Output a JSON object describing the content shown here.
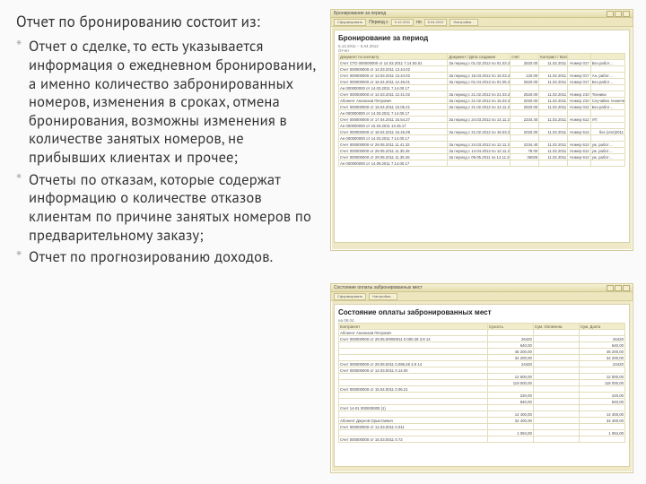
{
  "text": {
    "intro": "Отчет по бронированию состоит из:",
    "b1": "Отчет о сделке, то есть указывается информация о ежедневном бронировании, а именно количество забронированных номеров, изменения в сроках, отмена бронирования, возможны изменения в количестве занятых номеров, не прибывших клиентах и прочее;",
    "b2": "Отчеты по отказам, которые содержат информацию о количестве отказов клиентам по причине занятых номеров по предварительному заказу;",
    "b3": "Отчет по прогнозированию доходов."
  },
  "top": {
    "window_title": "Бронирование за период",
    "heading": "Бронирование за период",
    "toolbar": [
      "Сформировать",
      "Настройка…",
      "",
      ""
    ],
    "period_label": "Период с",
    "period_from": "5.12.2011",
    "period_to_label": "по",
    "period_to": "6.04.2012",
    "subhead": "Отчет",
    "date_range": "5.12.2011 – 6.04.2012",
    "columns": [
      "Документ по контакту",
      "Документ / Дата создания",
      "счет",
      "Контракт / Категория"
    ],
    "rows": [
      [
        "Счет СТО 000000000 от 14.03.2011 7.14.00.01",
        "За период с 01.02.2012 по 01.03.2012",
        "2520.00",
        "11.02.2011",
        "Номер 017",
        "Без работ…"
      ],
      [
        "Счет 000000000 от 14.03.2011 13.44.02",
        "",
        "",
        "",
        "",
        ""
      ],
      [
        "Счет 000000000 от 13.03.2011 13.44.02",
        "За период с 15.03.2012 по 15.03.2012",
        "120.00",
        "11.02.2011",
        "Номер 017",
        "Ан. работ…"
      ],
      [
        "Счет 000000000 от 16.04.2011 12.46.01",
        "За период с 01.04.2013 по 01.05.2013",
        "2520.00",
        "11.02.2011",
        "Номер 017",
        "Без работ…"
      ],
      [
        "Ан 000000000 от 14.03.2011 7.14.00.17",
        "",
        "",
        "",
        "",
        ""
      ],
      [
        "Счет 000000000 от 14.03.2011 12.41.02",
        "За период с 21.02.2012 по 21.03.2012",
        "2520.00",
        "11.02.2011",
        "Номер 210",
        "Техника"
      ],
      [
        "Абонент Анализов Петрович",
        "За период с 21.02.2012 по 15.03.2012",
        "2020.00",
        "11.02.2011",
        "Номер 210",
        "Случайно техническое"
      ],
      [
        "Счет 000000000 от 15.04.2011 15.06.21",
        "За период с 21.02.2012 по 14.11.2012",
        "2520.00",
        "11.02.2011",
        "Номер 012",
        "Без работ…"
      ],
      [
        "Ан 000000000 от 14.03.2011 7.14.00.17",
        "",
        "",
        "",
        "",
        ""
      ],
      [
        "Счет 000000000 от 17.04.2011 15.54.27",
        "За период с 24.03.2012 по 14.11.2012",
        "2234.40",
        "11.02.2011",
        "Номер 612",
        "УП"
      ],
      [
        "Ан 000000000 от 15.03.2011 13.45.17",
        "",
        "",
        "",
        "",
        ""
      ],
      [
        "Счет 000000000 от 18.04.2011 15.45.09",
        "За период с 21.02.2012 по 15.03.2012",
        "2020.00",
        "11.02.2011",
        "Номер 612",
        "без (опл)2011"
      ],
      [
        "Ан 000000000 от 14.03.2011 7.14.00.17",
        "",
        "",
        "",
        "",
        ""
      ],
      [
        "Счет 000000000 от 29.05.2011 11.41.32",
        "За период с 24.03.2012 по 12.11.2012",
        "2234.40",
        "11.02.2011",
        "Номер 612",
        "уж. работ…"
      ],
      [
        "Счет 000000000 от 29.05.2011 11.35.26",
        "За период с 14.04.2013 по 12.11.2012",
        "78.00",
        "11.02.2011",
        "Номер 612",
        "уж. работ…"
      ],
      [
        "Счет 000000000 от 29.05.2011 11.35.26",
        "За период с 09.05.2011 по 12.11.2012",
        "36025",
        "11.02.2011",
        "Номер 612",
        "уж. работ…"
      ],
      [
        "Ан 000000000 от 14.09.2011 7.14.00.17",
        "",
        "",
        "",
        "",
        ""
      ]
    ]
  },
  "bot": {
    "window_title": "Состояние оплаты забронированных мест",
    "heading": "Состояние оплаты забронированных мест",
    "asof_label": "на",
    "asof": "08.04.",
    "columns": [
      "Контрагент",
      "Сухость",
      "Сум. Оплачена",
      "Сум. Долга"
    ],
    "rows": [
      [
        "Абонент Анализов Петрович",
        "",
        "",
        ""
      ],
      [
        "Счет 000000000 от 29.05.00000011 0.000.28 3.9 14",
        "26420",
        "",
        "26420"
      ],
      [
        "",
        "640,00",
        "",
        "640,00"
      ],
      [
        "",
        "45 200,00",
        "",
        "45 200,00"
      ],
      [
        "",
        "34 200,00",
        "",
        "34 200,00"
      ],
      [
        "Счет 000000000 от 29.05.0011 0.096.28 3.9 14",
        "24420",
        "",
        "24420"
      ],
      [
        "Счет 000000000 от 14.03.0011 0.14.00",
        "",
        "",
        ""
      ],
      [
        "",
        "12 500,00",
        "",
        "12 500,00"
      ],
      [
        "",
        "118 000,00",
        "",
        "118 000,00"
      ],
      [
        "Счет 000000000 от 15.04.0011 0.06.21",
        "",
        "",
        ""
      ],
      [
        "",
        "220,00",
        "",
        "220,00"
      ],
      [
        "",
        "840,00",
        "",
        "840,00"
      ],
      [
        "Счет 14-01 000000000 (1)",
        "",
        "",
        ""
      ],
      [
        "",
        "14 400,00",
        "",
        "14 400,00"
      ],
      [
        "Абонент Джунов Орынтаевич",
        "34 400,00",
        "",
        "34 400,00"
      ],
      [
        "Счет 000000000 от 14.03.0011 0.011",
        "",
        "",
        ""
      ],
      [
        "",
        "1 094,00",
        "",
        "1 094,00"
      ],
      [
        "Счет 000000000 от 15.03.0011 0.72",
        "",
        "",
        ""
      ]
    ]
  }
}
